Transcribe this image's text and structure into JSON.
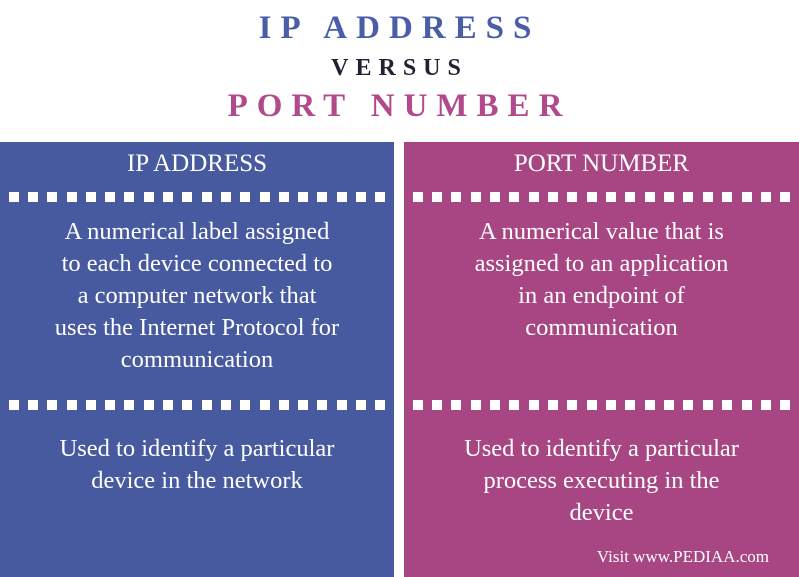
{
  "header": {
    "title_left": "IP ADDRESS",
    "versus": "VERSUS",
    "title_right": "PORT NUMBER"
  },
  "colors": {
    "blue_panel": "#475a9f",
    "pink_panel": "#a84684",
    "title_blue": "#4a5ea8",
    "title_pink": "#b04a8c"
  },
  "columns": [
    {
      "heading": "IP ADDRESS",
      "definition": "A numerical label assigned\nto each device connected to\na computer network that\nuses the Internet Protocol for\ncommunication",
      "purpose": "Used to identify a particular\ndevice in the network"
    },
    {
      "heading": "PORT NUMBER",
      "definition": "A numerical value that is\nassigned to an application\nin an endpoint of\ncommunication",
      "purpose": "Used to identify a particular\nprocess executing in the\ndevice"
    }
  ],
  "footer": "Visit www.PEDIAA.com"
}
